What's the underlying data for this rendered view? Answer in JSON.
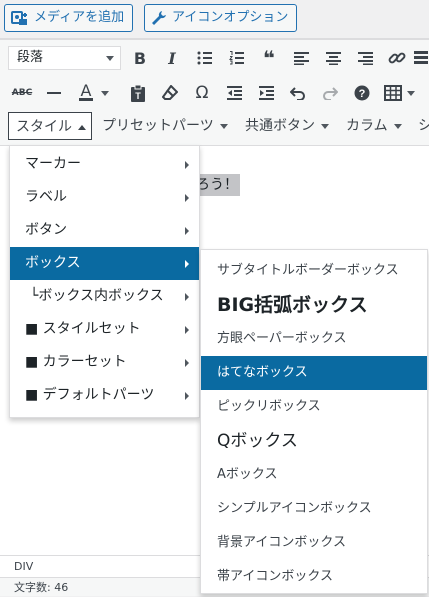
{
  "media_buttons": {
    "add_media": "メディアを追加",
    "icon_options": "アイコンオプション"
  },
  "toolbar1": {
    "format_select": "段落",
    "buttons": [
      "bold-icon",
      "italic-icon",
      "bullet-list-icon",
      "numbered-list-icon",
      "blockquote-icon",
      "align-left-icon",
      "align-center-icon",
      "align-right-icon",
      "link-icon",
      "toolbar-toggle-icon"
    ]
  },
  "toolbar2": {
    "buttons": [
      "strikethrough-icon",
      "horizontal-line-icon",
      "text-color-icon",
      "paste-as-text-icon",
      "clear-formatting-icon",
      "special-character-icon",
      "outdent-icon",
      "indent-icon",
      "undo-icon",
      "redo-icon",
      "help-icon",
      "table-icon"
    ]
  },
  "toolbar3": {
    "style": "スタイル",
    "preset": "プリセットパーツ",
    "common": "共通ボタン",
    "column": "カラム",
    "more": "シ"
  },
  "editor": {
    "visible_fragment": "ろう！"
  },
  "style_menu": {
    "items": [
      {
        "label": "マーカー"
      },
      {
        "label": "ラベル"
      },
      {
        "label": "ボタン"
      },
      {
        "label": "ボックス"
      },
      {
        "label": "└ボックス内ボックス"
      },
      {
        "label": "■ スタイルセット"
      },
      {
        "label": "■ カラーセット"
      },
      {
        "label": "■ デフォルトパーツ"
      }
    ],
    "selected_index": 3
  },
  "box_submenu": {
    "items": [
      {
        "label": "サブタイトルボーダーボックス"
      },
      {
        "label": "BIG括弧ボックス"
      },
      {
        "label": "方眼ペーパーボックス"
      },
      {
        "label": "はてなボックス"
      },
      {
        "label": "ピックリボックス"
      },
      {
        "label": "Qボックス"
      },
      {
        "label": "Aボックス"
      },
      {
        "label": "シンプルアイコンボックス"
      },
      {
        "label": "背景アイコンボックス"
      },
      {
        "label": "帯アイコンボックス"
      }
    ],
    "selected_index": 3
  },
  "status": {
    "path": "DIV",
    "word_count": "文字数: 46"
  },
  "colors": {
    "selected": "#0a6aa1",
    "wp_blue": "#2271b1"
  }
}
